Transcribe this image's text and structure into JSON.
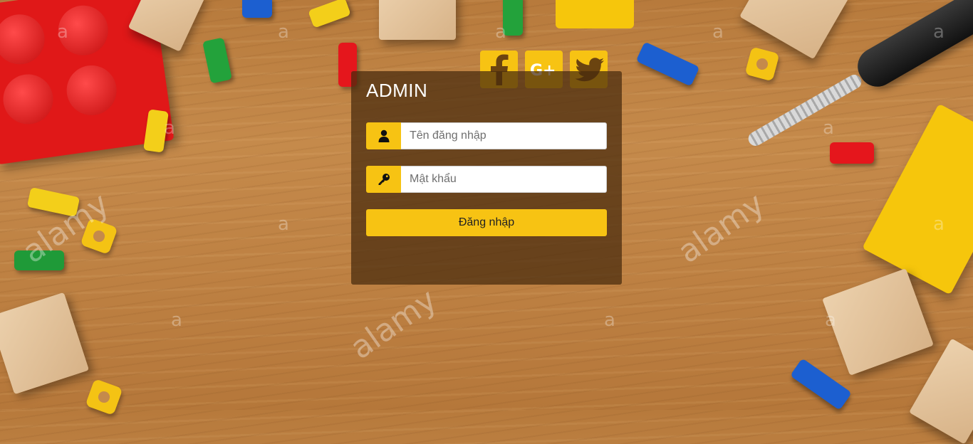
{
  "colors": {
    "accent": "#f7c313",
    "panel": "rgba(70,42,12,0.72)"
  },
  "social": [
    {
      "name": "facebook",
      "icon": "facebook-icon"
    },
    {
      "name": "google-plus",
      "icon": "google-plus-icon"
    },
    {
      "name": "twitter",
      "icon": "twitter-icon"
    }
  ],
  "login": {
    "title": "ADMIN",
    "username": {
      "value": "",
      "placeholder": "Tên đăng nhập",
      "icon": "user-icon"
    },
    "password": {
      "value": "",
      "placeholder": "Mật khẩu",
      "icon": "key-icon"
    },
    "submit_label": "Đăng nhập"
  },
  "background": {
    "watermark_text": "alamy",
    "watermark_mark": "a"
  }
}
